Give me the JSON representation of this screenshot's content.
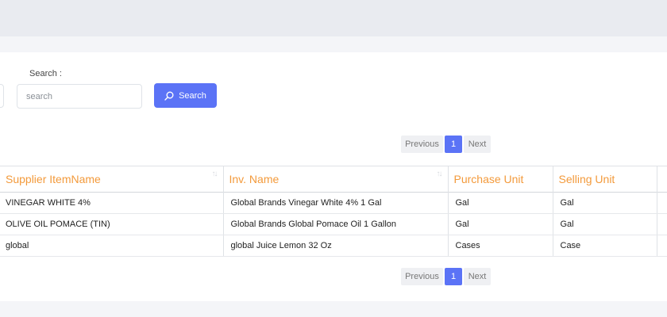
{
  "search": {
    "label": "Search :",
    "placeholder": "search",
    "button_label": "Search"
  },
  "pagination": {
    "previous": "Previous",
    "current": "1",
    "next": "Next"
  },
  "table": {
    "columns": [
      "Supplier ItemName",
      "Inv. Name",
      "Purchase Unit",
      "Selling Unit"
    ],
    "rows": [
      [
        "VINEGAR WHITE 4%",
        "Global Brands Vinegar White 4% 1 Gal",
        "Gal",
        "Gal"
      ],
      [
        "OLIVE OIL POMACE (TIN)",
        "Global Brands Global Pomace Oil 1 Gallon",
        "Gal",
        "Gal"
      ],
      [
        "global",
        "global Juice Lemon 32 Oz",
        "Cases",
        "Case"
      ]
    ]
  },
  "colors": {
    "accent": "#5b73f6",
    "header_text": "#f39a3b"
  }
}
